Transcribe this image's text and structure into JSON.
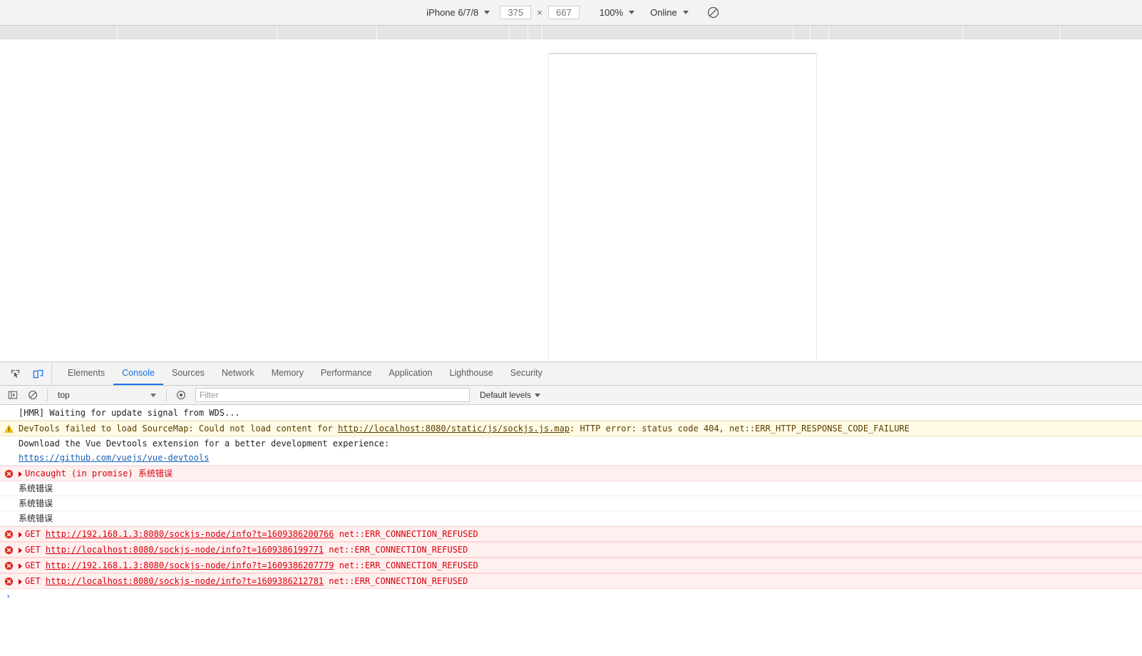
{
  "device_toolbar": {
    "device": "iPhone 6/7/8",
    "width_value": "375",
    "width_placeholder": "375",
    "x_symbol": "×",
    "height_value": "667",
    "height_placeholder": "667",
    "zoom": "100%",
    "network": "Online",
    "throttle_icon": "no-throttling-icon"
  },
  "devtools": {
    "tabs": [
      {
        "label": "Elements",
        "active": false
      },
      {
        "label": "Console",
        "active": true
      },
      {
        "label": "Sources",
        "active": false
      },
      {
        "label": "Network",
        "active": false
      },
      {
        "label": "Memory",
        "active": false
      },
      {
        "label": "Performance",
        "active": false
      },
      {
        "label": "Application",
        "active": false
      },
      {
        "label": "Lighthouse",
        "active": false
      },
      {
        "label": "Security",
        "active": false
      }
    ],
    "inspect_icon": "inspect-element-icon",
    "device_toggle_icon": "device-toolbar-icon"
  },
  "console_toolbar": {
    "sidebar_icon": "console-sidebar-icon",
    "clear_icon": "clear-console-icon",
    "context": "top",
    "eye_icon": "live-expression-icon",
    "filter_placeholder": "Filter",
    "filter_value": "",
    "levels": "Default levels"
  },
  "console_messages": [
    {
      "type": "plain",
      "icon": "",
      "expandable": false,
      "parts": [
        {
          "t": "text",
          "v": "[HMR] Waiting for update signal from WDS..."
        }
      ]
    },
    {
      "type": "warning",
      "icon": "warning-icon",
      "expandable": false,
      "parts": [
        {
          "t": "text",
          "v": "DevTools failed to load SourceMap: Could not load content for "
        },
        {
          "t": "link",
          "v": "http://localhost:8080/static/js/sockjs.js.map"
        },
        {
          "t": "text",
          "v": ": HTTP error: status code 404, net::ERR_HTTP_RESPONSE_CODE_FAILURE"
        }
      ]
    },
    {
      "type": "plain",
      "icon": "",
      "expandable": false,
      "no_border": true,
      "parts": [
        {
          "t": "text",
          "v": "Download the Vue Devtools extension for a better development experience:"
        }
      ]
    },
    {
      "type": "plain",
      "icon": "",
      "expandable": false,
      "parts": [
        {
          "t": "link",
          "v": "https://github.com/vuejs/vue-devtools"
        }
      ]
    },
    {
      "type": "error",
      "icon": "error-icon",
      "expandable": true,
      "parts": [
        {
          "t": "text",
          "v": "Uncaught (in promise) "
        },
        {
          "t": "cn",
          "v": "系统错误"
        }
      ]
    },
    {
      "type": "plain",
      "icon": "",
      "expandable": false,
      "parts": [
        {
          "t": "cn",
          "v": "系统错误"
        }
      ]
    },
    {
      "type": "plain",
      "icon": "",
      "expandable": false,
      "parts": [
        {
          "t": "cn",
          "v": "系统错误"
        }
      ]
    },
    {
      "type": "plain",
      "icon": "",
      "expandable": false,
      "parts": [
        {
          "t": "cn",
          "v": "系统错误"
        }
      ]
    },
    {
      "type": "error",
      "icon": "error-icon",
      "expandable": true,
      "parts": [
        {
          "t": "text",
          "v": "GET "
        },
        {
          "t": "link",
          "v": "http://192.168.1.3:8080/sockjs-node/info?t=1609386200766"
        },
        {
          "t": "text",
          "v": " net::ERR_CONNECTION_REFUSED"
        }
      ]
    },
    {
      "type": "error",
      "icon": "error-icon",
      "expandable": true,
      "parts": [
        {
          "t": "text",
          "v": "GET "
        },
        {
          "t": "link",
          "v": "http://localhost:8080/sockjs-node/info?t=1609386199771"
        },
        {
          "t": "text",
          "v": " net::ERR_CONNECTION_REFUSED"
        }
      ]
    },
    {
      "type": "error",
      "icon": "error-icon",
      "expandable": true,
      "parts": [
        {
          "t": "text",
          "v": "GET "
        },
        {
          "t": "link",
          "v": "http://192.168.1.3:8080/sockjs-node/info?t=1609386207779"
        },
        {
          "t": "text",
          "v": " net::ERR_CONNECTION_REFUSED"
        }
      ]
    },
    {
      "type": "error",
      "icon": "error-icon",
      "expandable": true,
      "parts": [
        {
          "t": "text",
          "v": "GET "
        },
        {
          "t": "link",
          "v": "http://localhost:8080/sockjs-node/info?t=1609386212781"
        },
        {
          "t": "text",
          "v": " net::ERR_CONNECTION_REFUSED"
        }
      ]
    }
  ],
  "console_prompt": {
    "caret": "›",
    "value": ""
  },
  "ruler": {
    "tick_positions": [
      164,
      388,
      528,
      714,
      740,
      760,
      1112,
      1136,
      1162,
      1350,
      1486
    ]
  },
  "colors": {
    "accent": "#1a73e8",
    "error": "#d8000c",
    "error_bg": "#fff0f0",
    "warning_bg": "#fffbe5",
    "toolbar_bg": "#f3f3f3"
  }
}
